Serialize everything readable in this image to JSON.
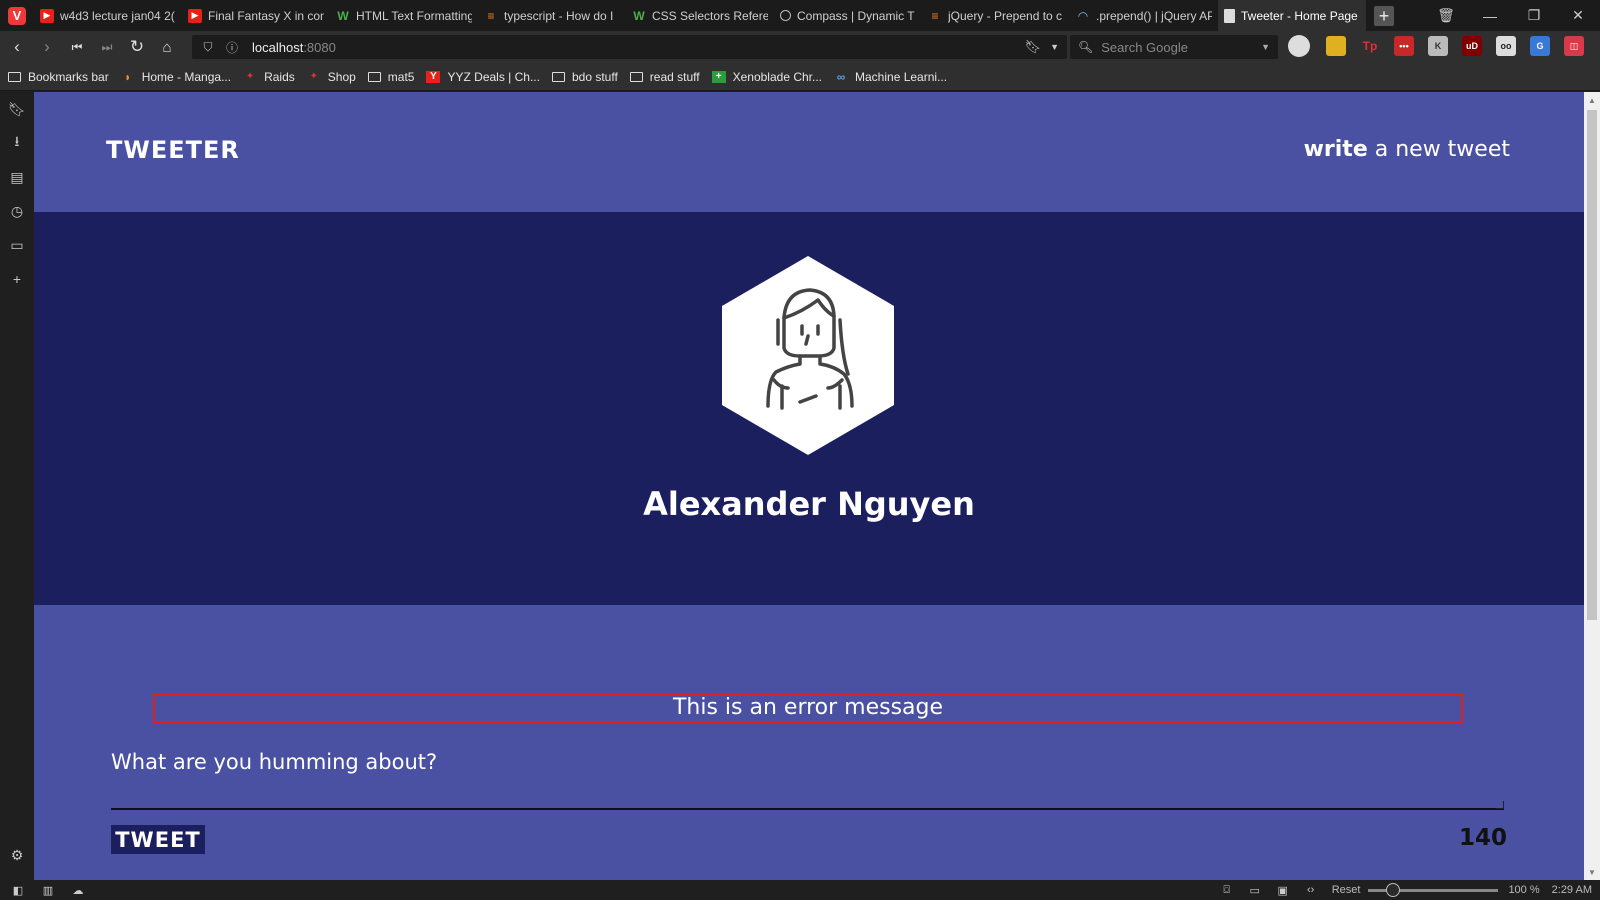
{
  "browser": {
    "tabs": [
      {
        "label": "w4d3 lecture jan04 2(",
        "icon": "youtube-icon"
      },
      {
        "label": "Final Fantasy X in con",
        "icon": "youtube-icon"
      },
      {
        "label": "HTML Text Formatting",
        "icon": "w3schools-icon"
      },
      {
        "label": "typescript - How do I",
        "icon": "stackoverflow-icon"
      },
      {
        "label": "CSS Selectors Referen",
        "icon": "w3schools-icon"
      },
      {
        "label": "Compass | Dynamic T",
        "icon": "github-icon"
      },
      {
        "label": "jQuery - Prepend to c",
        "icon": "stackoverflow-icon"
      },
      {
        "label": ".prepend() | jQuery AP",
        "icon": "jquery-icon"
      },
      {
        "label": "Tweeter - Home Page",
        "icon": "document-icon",
        "active": true
      }
    ],
    "url_host": "localhost",
    "url_port": ":8080",
    "search_placeholder": "Search Google",
    "bookmarks": [
      {
        "label": "Bookmarks bar",
        "icon": "folder-icon"
      },
      {
        "label": "Home - Manga...",
        "icon": "manga-icon"
      },
      {
        "label": "Raids",
        "icon": "raid-icon"
      },
      {
        "label": "Shop",
        "icon": "shop-icon"
      },
      {
        "label": "mat5",
        "icon": "folder-icon"
      },
      {
        "label": "YYZ Deals | Ch...",
        "icon": "yyz-icon"
      },
      {
        "label": "bdo stuff",
        "icon": "folder-icon"
      },
      {
        "label": "read stuff",
        "icon": "folder-icon"
      },
      {
        "label": "Xenoblade Chr...",
        "icon": "xenoblade-icon"
      },
      {
        "label": "Machine Learni...",
        "icon": "link-icon"
      }
    ],
    "status": {
      "reset_label": "Reset",
      "zoom": "100 %",
      "clock": "2:29 AM"
    }
  },
  "page": {
    "brand": "TWEETER",
    "nav_write_bold": "write",
    "nav_write_rest": " a new tweet",
    "username": "Alexander Nguyen",
    "error_message": "This is an error message",
    "tweet_placeholder": "What are you humming about?",
    "tweet_button": "TWEET",
    "char_counter": "140",
    "colors": {
      "nav_bg": "#4a51a2",
      "hero_bg": "#1c1f5e",
      "error_border": "#e02020"
    }
  }
}
